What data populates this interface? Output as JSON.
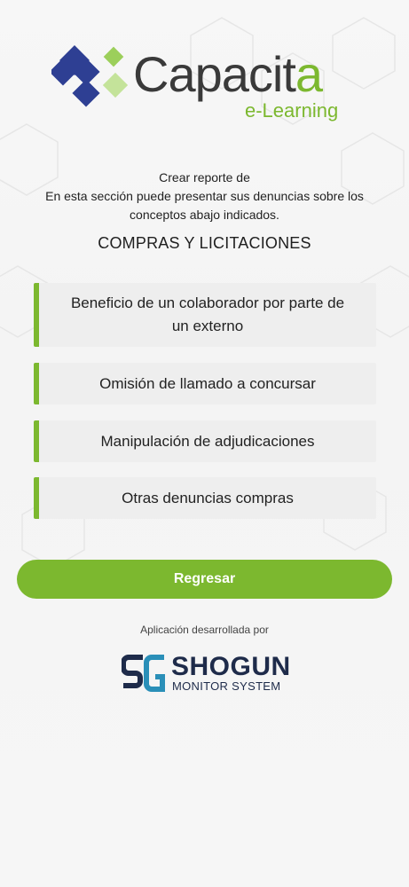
{
  "brand": {
    "name_main": "Capacit",
    "name_accent": "a",
    "tagline": "e-Learning",
    "colors": {
      "green": "#7cb82f",
      "navy": "#2e3f93",
      "gray": "#3a3a3a"
    }
  },
  "intro": {
    "line1": "Crear reporte de",
    "line2": "En esta sección puede presentar sus denuncias sobre los conceptos abajo indicados."
  },
  "section_title": "COMPRAS Y LICITACIONES",
  "options": [
    {
      "label": "Beneficio de un colaborador por parte de un externo"
    },
    {
      "label": "Omisión de llamado a concursar"
    },
    {
      "label": "Manipulación de adjudicaciones"
    },
    {
      "label": "Otras denuncias compras"
    }
  ],
  "back_button": {
    "label": "Regresar"
  },
  "developer": {
    "caption": "Aplicación desarrollada por",
    "name": "SHOGUN",
    "subtitle": "MONITOR SYSTEM",
    "mark_icon": "sg-logo-icon",
    "color": "#1e2b4a"
  }
}
